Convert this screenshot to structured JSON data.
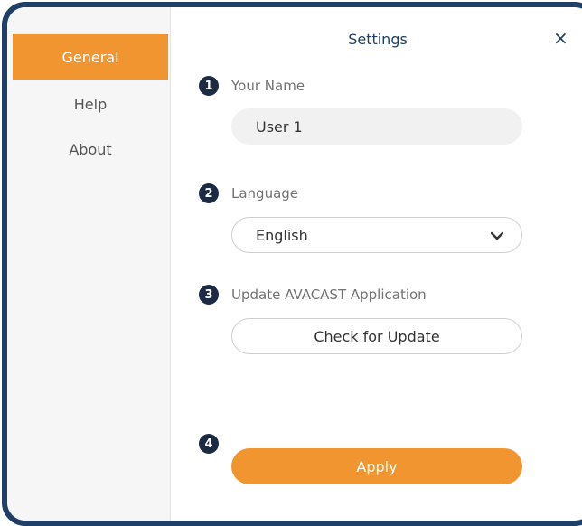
{
  "window": {
    "title": "Settings",
    "close_glyph": "×"
  },
  "sidebar": {
    "items": [
      {
        "label": "General",
        "active": true
      },
      {
        "label": "Help",
        "active": false
      },
      {
        "label": "About",
        "active": false
      }
    ]
  },
  "settings": {
    "name": {
      "number": "1",
      "label": "Your Name",
      "value": "User 1"
    },
    "language": {
      "number": "2",
      "label": "Language",
      "selected": "English",
      "chevron_icon": "chevron-down-icon"
    },
    "update": {
      "number": "3",
      "label": "Update AVACAST Application",
      "button_label": "Check for Update"
    },
    "apply": {
      "number": "4",
      "button_label": "Apply"
    }
  },
  "colors": {
    "accent": "#f0952f",
    "frame": "#1f3f66",
    "badge": "#1c2a44"
  }
}
